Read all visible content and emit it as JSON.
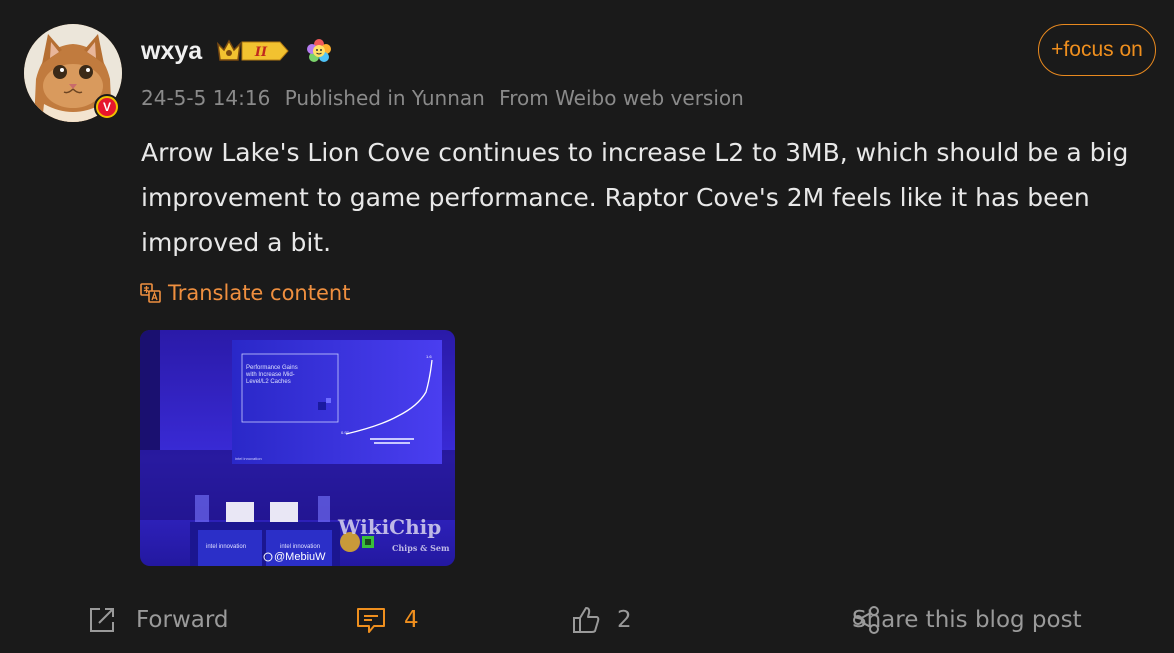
{
  "post": {
    "username": "wxya",
    "level_badge": "II",
    "date": "24-5-5 14:16",
    "location": "Published in Yunnan",
    "source": "From Weibo web version",
    "follow_label": "+focus on",
    "text": "Arrow Lake's Lion Cove continues to increase L2 to 3MB, which should be a big improvement to game performance. Raptor Cove's 2M feels like it has been improved a bit.",
    "translate_label": "Translate content"
  },
  "image": {
    "slide_title": "Performance Gains with Increase Mid-Level/L2 Caches",
    "slide_axis_low": "0.97",
    "slide_axis_high": "1.6",
    "watermark_main": "WikiChip",
    "watermark_sub": "Chips & Sem",
    "handle": "@MebiuW",
    "booth_label_1": "intel innovation",
    "booth_label_2": "intel innovation"
  },
  "actions": {
    "forward_label": "Forward",
    "comment_count": "4",
    "like_count": "2",
    "share_label": "Share this blog post"
  },
  "colors": {
    "accent": "#ef8f1e",
    "background": "#1a1a1a",
    "badge_red": "#e6162d"
  }
}
